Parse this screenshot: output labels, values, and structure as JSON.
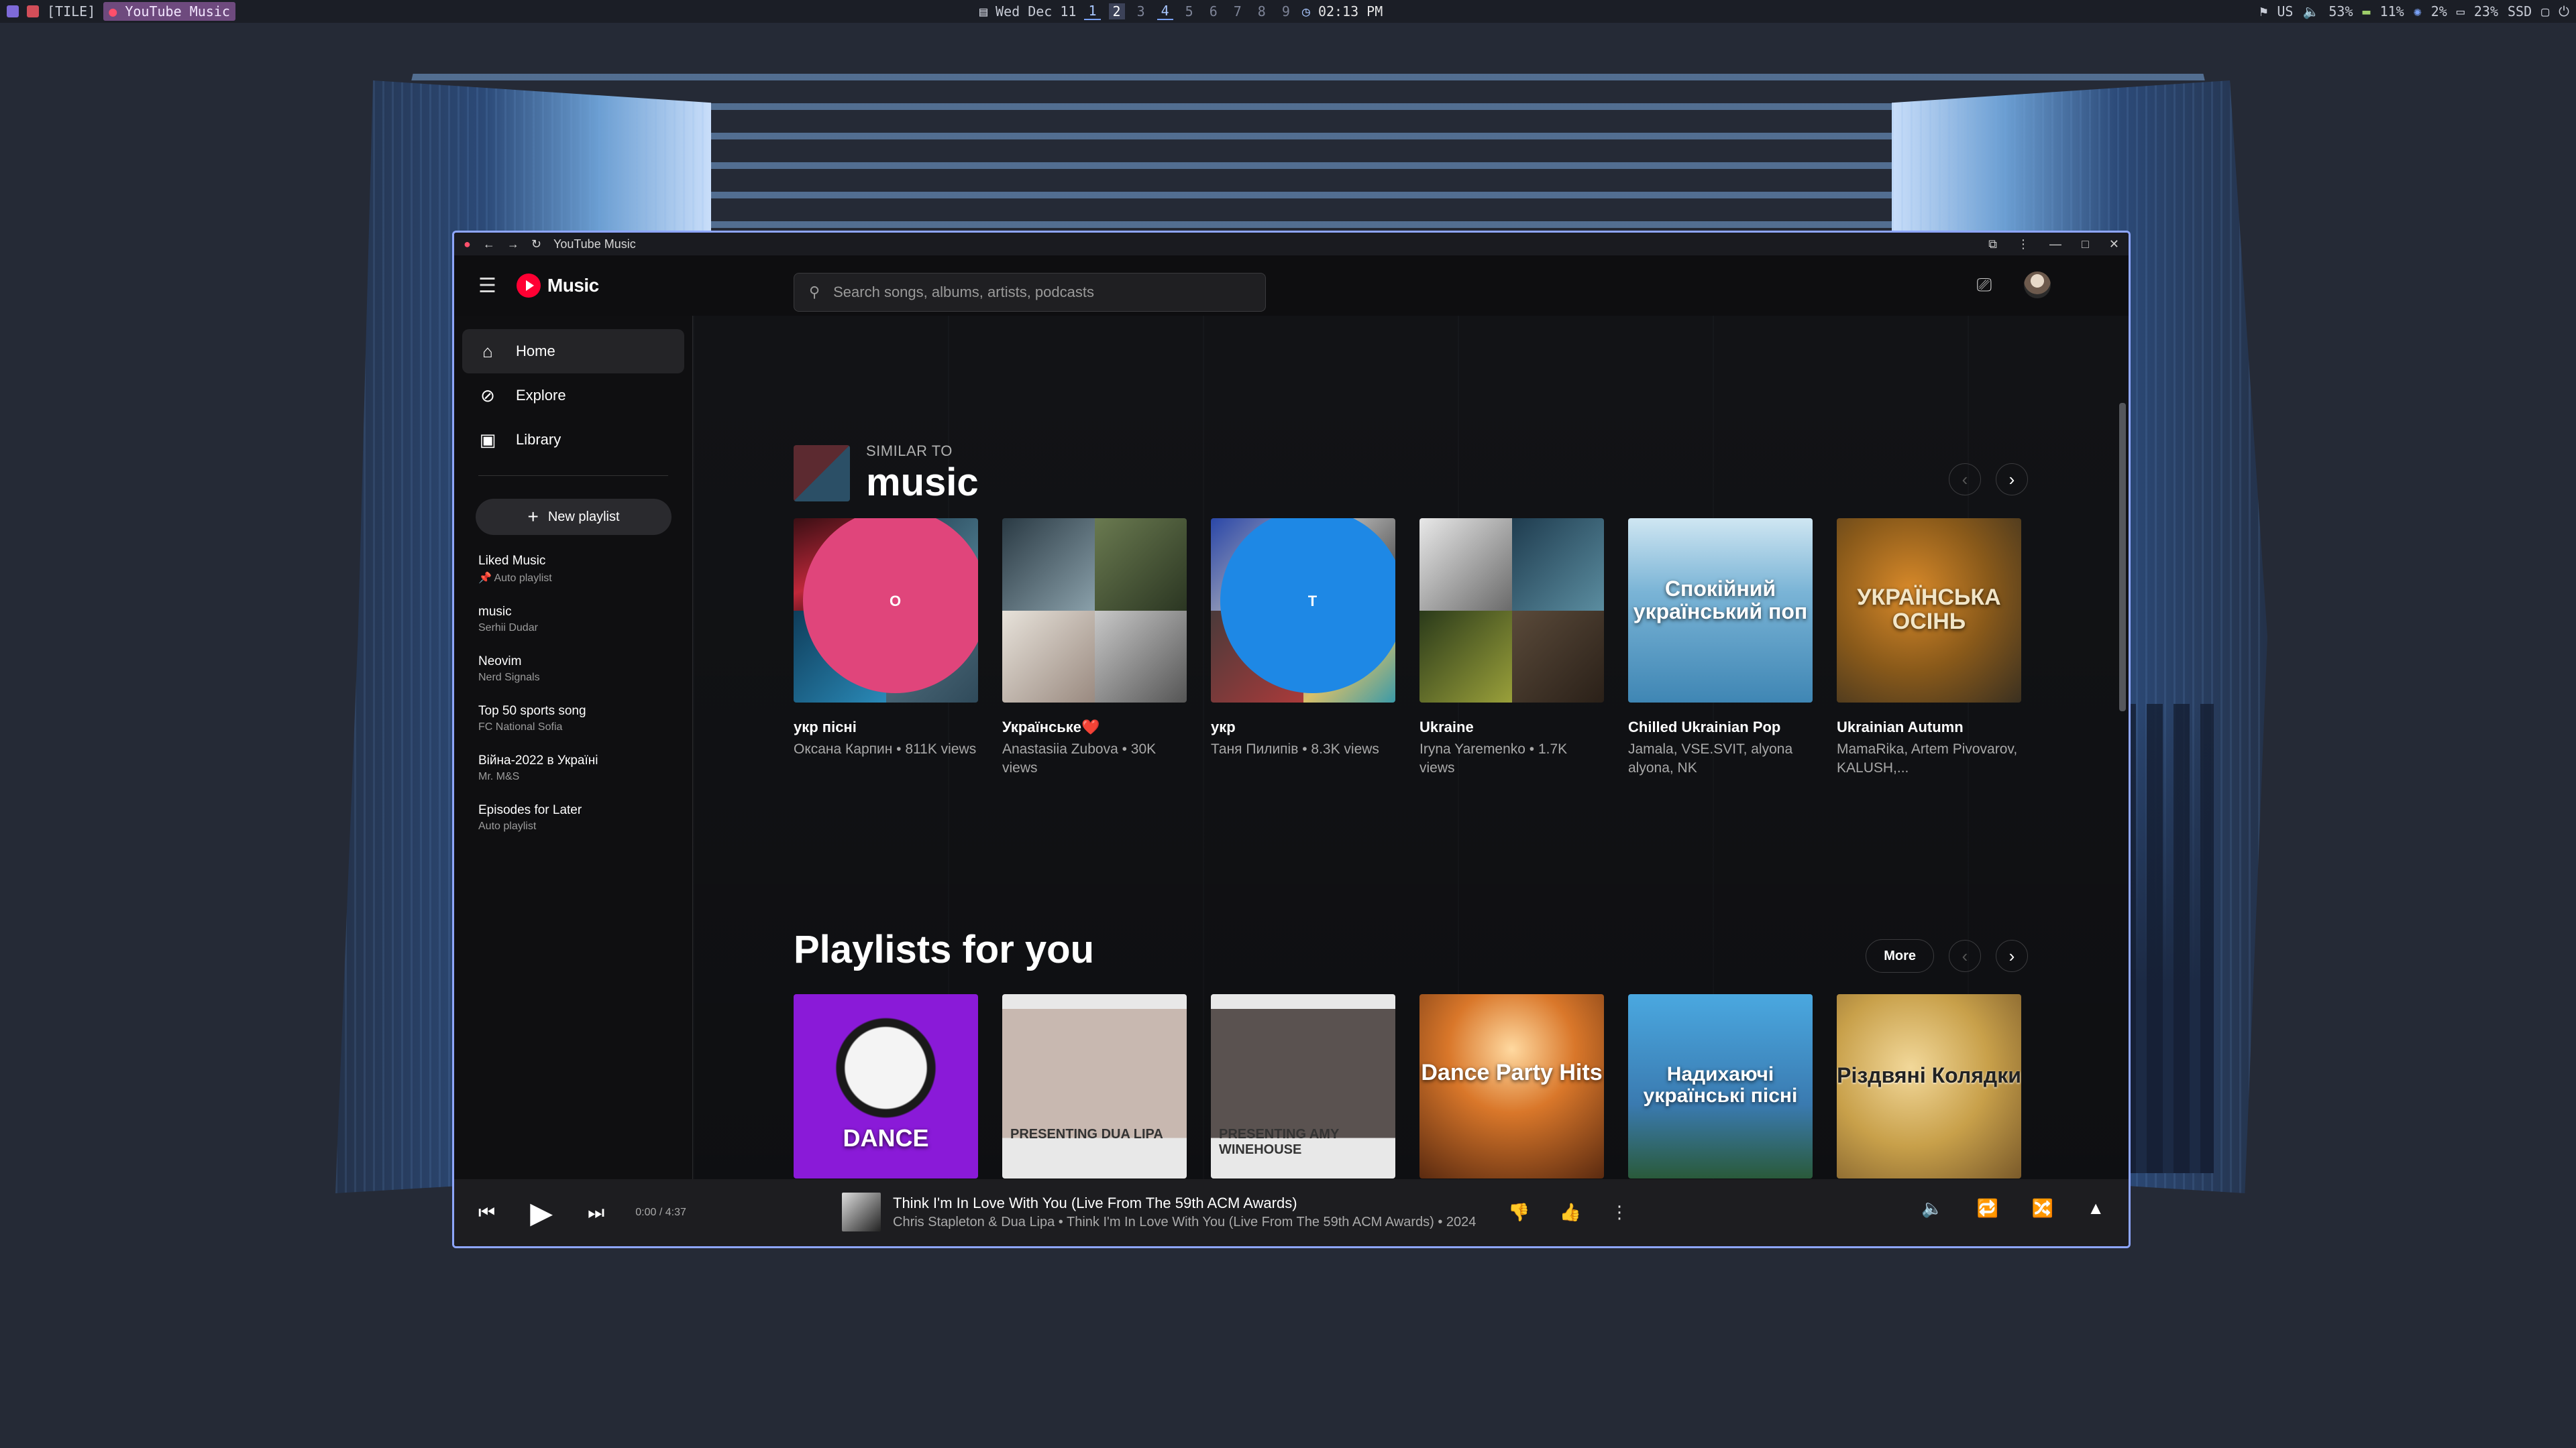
{
  "topbar": {
    "layout_label": "[TILE]",
    "app_pill": "YouTube Music",
    "date": "Wed Dec 11",
    "workspaces": [
      "1",
      "2",
      "3",
      "4",
      "5",
      "6",
      "7",
      "8",
      "9"
    ],
    "time": "02:13 PM",
    "locale": "US",
    "volume": "53%",
    "mem": "11%",
    "cpu": "2%",
    "disk": "23%",
    "disk_label": "SSD"
  },
  "window": {
    "title": "YouTube Music"
  },
  "header": {
    "logo_text": "Music",
    "search_placeholder": "Search songs, albums, artists, podcasts"
  },
  "sidebar": {
    "nav": [
      {
        "label": "Home",
        "icon": "home-icon"
      },
      {
        "label": "Explore",
        "icon": "compass-icon"
      },
      {
        "label": "Library",
        "icon": "library-icon"
      }
    ],
    "new_playlist": "New playlist",
    "playlists": [
      {
        "title": "Liked Music",
        "sub": "Auto playlist"
      },
      {
        "title": "music",
        "sub": "Serhii Dudar"
      },
      {
        "title": "Neovim",
        "sub": "Nerd Signals"
      },
      {
        "title": "Top 50 sports song",
        "sub": "FC National Sofia"
      },
      {
        "title": "Війна-2022 в Україні",
        "sub": "Mr. M&S"
      },
      {
        "title": "Episodes for Later",
        "sub": "Auto playlist"
      }
    ]
  },
  "section1": {
    "kicker": "SIMILAR TO",
    "title": "music",
    "cards": [
      {
        "title": "укр пісні",
        "sub": "Оксана Карпин • 811K views",
        "badge": "O",
        "badge_color": "#e0457b"
      },
      {
        "title": "Українське❤️",
        "sub": "Anastasiia Zubova • 30K views"
      },
      {
        "title": "укр",
        "sub": "Таня Пилипів • 8.3K views",
        "badge": "T",
        "badge_color": "#1e88e5"
      },
      {
        "title": "Ukraine",
        "sub": "Iryna Yaremenko • 1.7K views"
      },
      {
        "title": "Chilled Ukrainian Pop",
        "sub": "Jamala, VSE.SVIT, alyona alyona, NK",
        "art_text": "Спокійний український поп"
      },
      {
        "title": "Ukrainian Autumn",
        "sub": "MamaRika, Artem Pivovarov, KALUSH,...",
        "art_text": "УКРАЇНСЬКА ОСІНЬ"
      }
    ]
  },
  "section2": {
    "title": "Playlists for you",
    "more": "More",
    "cards": [
      {
        "art_text": "DANCE"
      },
      {
        "art_text": "PRESENTING DUA LIPA"
      },
      {
        "art_text": "PRESENTING AMY WINEHOUSE"
      },
      {
        "art_text": "Dance Party Hits"
      },
      {
        "art_text": "Надихаючі українські пісні"
      },
      {
        "art_text": "Різдвяні Колядки"
      }
    ]
  },
  "player": {
    "time": "0:00 / 4:37",
    "title": "Think I'm In Love With You (Live From The 59th ACM Awards)",
    "sub": "Chris Stapleton & Dua Lipa • Think I'm In Love With You (Live From The 59th ACM Awards) • 2024"
  },
  "colors": {
    "accent": "#ff0033",
    "window_border": "#8ea6ff"
  }
}
